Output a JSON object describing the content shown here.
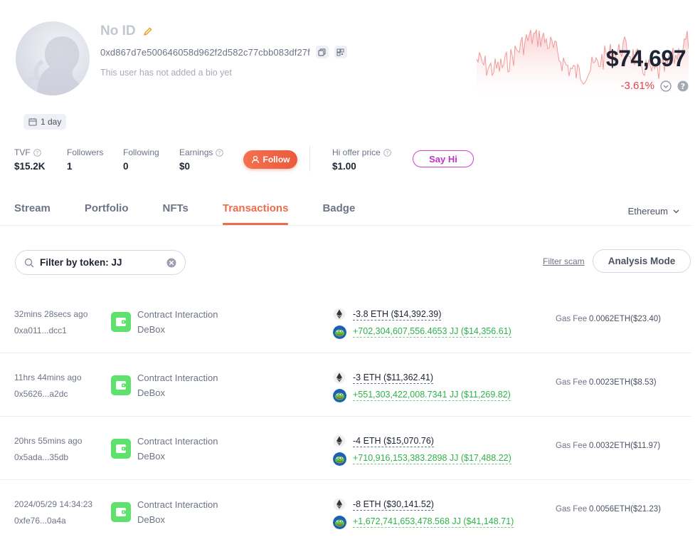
{
  "profile": {
    "name": "No ID",
    "address": "0xd867d7e500646058d962f2d582c77cbb083df27f",
    "bio": "This user has not added a bio yet",
    "age": "1 day"
  },
  "price": {
    "value": "$74,697",
    "change": "-3.61%"
  },
  "stats": {
    "tvf_label": "TVF",
    "tvf_value": "$15.2K",
    "followers_label": "Followers",
    "followers_value": "1",
    "following_label": "Following",
    "following_value": "0",
    "earnings_label": "Earnings",
    "earnings_value": "$0",
    "follow_label": "Follow",
    "hi_offer_label": "Hi offer price",
    "hi_offer_value": "$1.00",
    "say_hi_label": "Say Hi"
  },
  "tabs": [
    {
      "label": "Stream"
    },
    {
      "label": "Portfolio"
    },
    {
      "label": "NFTs"
    },
    {
      "label": "Transactions",
      "active": true
    },
    {
      "label": "Badge"
    }
  ],
  "network": "Ethereum",
  "filter": {
    "text": "Filter by token: JJ",
    "filter_scam": "Filter scam",
    "analysis_mode": "Analysis Mode"
  },
  "transactions": [
    {
      "time": "32mins 28secs ago",
      "hash": "0xa011...dcc1",
      "type": "Contract Interaction",
      "app": "DeBox",
      "out": "-3.8 ETH ($14,392.39)",
      "in": "+702,304,607,556.4653 JJ ($14,356.61)",
      "gas_label": "Gas Fee",
      "gas": "0.0062ETH($23.40)"
    },
    {
      "time": "11hrs 44mins ago",
      "hash": "0x5626...a2dc",
      "type": "Contract Interaction",
      "app": "DeBox",
      "out": "-3 ETH ($11,362.41)",
      "in": "+551,303,422,008.7341 JJ ($11,269.82)",
      "gas_label": "Gas Fee",
      "gas": "0.0023ETH($8.53)"
    },
    {
      "time": "20hrs 55mins ago",
      "hash": "0x5ada...35db",
      "type": "Contract Interaction",
      "app": "DeBox",
      "out": "-4 ETH ($15,070.76)",
      "in": "+710,916,153,383.2898 JJ ($17,488.22)",
      "gas_label": "Gas Fee",
      "gas": "0.0032ETH($11.97)"
    },
    {
      "time": "2024/05/29 14:34:23",
      "hash": "0xfe76...0a4a",
      "type": "Contract Interaction",
      "app": "DeBox",
      "out": "-8 ETH ($30,141.52)",
      "in": "+1,672,741,653,478.568 JJ ($41,148.71)",
      "gas_label": "Gas Fee",
      "gas": "0.0056ETH($21.23)"
    }
  ],
  "icons": {
    "avatar": "default-avatar",
    "edit": "pencil-icon",
    "copy": "copy-icon",
    "qr": "qr-code-icon",
    "calendar": "calendar-icon",
    "chevron": "chevron-down-icon",
    "help": "question-icon",
    "search": "search-icon",
    "clear": "close-circle-icon",
    "eth": "ethereum-icon",
    "jj": "jj-token-icon",
    "app": "debox-icon"
  },
  "colors": {
    "accent": "#ef6b4c",
    "negative": "#e0434f",
    "positive": "#2fb24b",
    "say_hi": "#c233c4",
    "app_green": "#5ee16d"
  }
}
